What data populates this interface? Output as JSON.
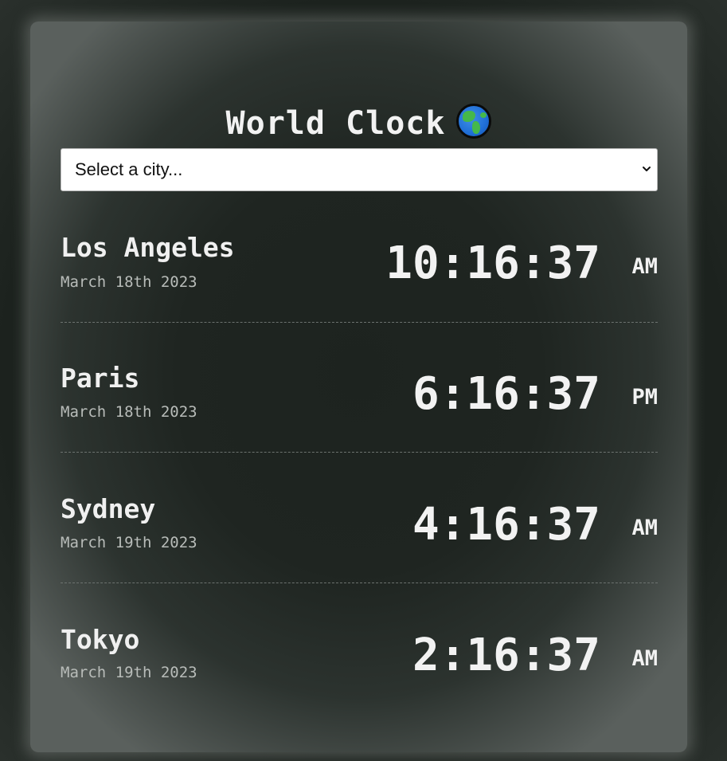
{
  "app": {
    "title": "World Clock"
  },
  "city_select": {
    "selected_label": "Select a city..."
  },
  "clocks": [
    {
      "city": "Los Angeles",
      "date": "March 18th 2023",
      "time": "10:16:37",
      "ampm": "AM"
    },
    {
      "city": "Paris",
      "date": "March 18th 2023",
      "time": "6:16:37",
      "ampm": "PM"
    },
    {
      "city": "Sydney",
      "date": "March 19th 2023",
      "time": "4:16:37",
      "ampm": "AM"
    },
    {
      "city": "Tokyo",
      "date": "March 19th 2023",
      "time": "2:16:37",
      "ampm": "AM"
    }
  ],
  "icons": {
    "title_icon": "globe-americas-icon",
    "select_chevron": "chevron-down-icon"
  },
  "colors": {
    "text": "#f2f2f2",
    "muted_text": "#b8bcb9",
    "card_bg": "#1f2521",
    "separator": "#6c726f"
  }
}
